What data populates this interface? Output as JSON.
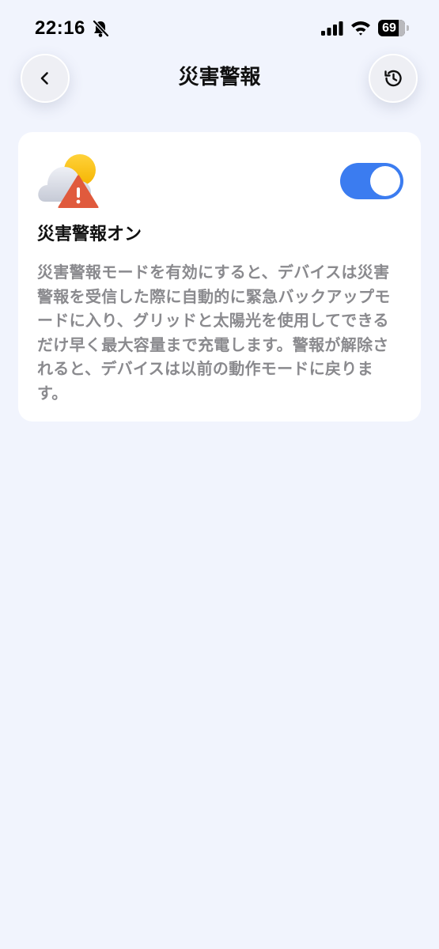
{
  "status_bar": {
    "time": "22:16",
    "battery_level": "69",
    "icons": [
      "bell-slash-icon",
      "cellular-signal-icon",
      "wifi-icon",
      "battery-icon"
    ]
  },
  "header": {
    "title": "災害警報",
    "back_icon": "chevron-left-icon",
    "history_icon": "history-icon"
  },
  "card": {
    "icon": "cloud-sun-warning-icon",
    "title": "災害警報オン",
    "toggle_on": true,
    "description": "災害警報モードを有効にすると、デバイスは災害警報を受信した際に自動的に緊急バックアップモードに入り、グリッドと太陽光を使用してできるだけ早く最大容量まで充電します。警報が解除されると、デバイスは以前の動作モードに戻ります。"
  },
  "colors": {
    "background": "#f1f4fd",
    "card": "#ffffff",
    "accent": "#3b7cf0",
    "warning": "#e05a3d",
    "muted_text": "#8a8a8e"
  }
}
